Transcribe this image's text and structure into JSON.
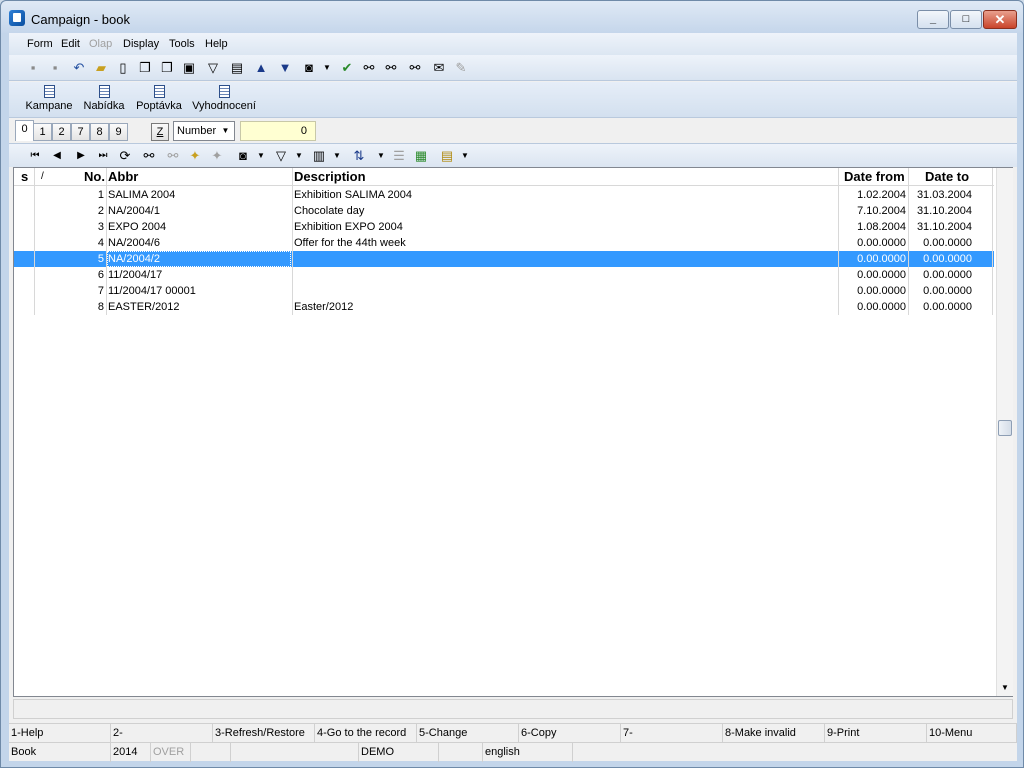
{
  "window": {
    "title": "Campaign - book",
    "minimize": "_",
    "maximize": "□",
    "close": "✕"
  },
  "menu": {
    "form": "Form",
    "edit": "Edit",
    "olap": "Olap",
    "display": "Display",
    "tools": "Tools",
    "help": "Help"
  },
  "toolbar2": {
    "kampane": "Kampane",
    "nabidka": "Nabídka",
    "poptavka": "Poptávka",
    "vyhodnoceni": "Vyhodnocení"
  },
  "tabs": [
    "0",
    "1",
    "2",
    "7",
    "8",
    "9"
  ],
  "filter": {
    "z_label": "Z",
    "sort_field": "Number",
    "value": "0"
  },
  "grid": {
    "headers": {
      "s": "s",
      "slash": "/",
      "no": "No.",
      "abbr": "Abbr",
      "description": "Description",
      "date_from": "Date from",
      "date_to": "Date to"
    },
    "rows": [
      {
        "no": "1",
        "abbr": "SALIMA 2004",
        "description": "Exhibition SALIMA 2004",
        "date_from": "1.02.2004",
        "date_to": "31.03.2004"
      },
      {
        "no": "2",
        "abbr": "NA/2004/1",
        "description": "Chocolate day",
        "date_from": "7.10.2004",
        "date_to": "31.10.2004"
      },
      {
        "no": "3",
        "abbr": "EXPO 2004",
        "description": "Exhibition EXPO 2004",
        "date_from": "1.08.2004",
        "date_to": "31.10.2004"
      },
      {
        "no": "4",
        "abbr": "NA/2004/6",
        "description": "Offer for the 44th week",
        "date_from": "0.00.0000",
        "date_to": "0.00.0000"
      },
      {
        "no": "5",
        "abbr": "NA/2004/2",
        "description": "",
        "date_from": "0.00.0000",
        "date_to": "0.00.0000"
      },
      {
        "no": "6",
        "abbr": "11/2004/17",
        "description": "",
        "date_from": "0.00.0000",
        "date_to": "0.00.0000"
      },
      {
        "no": "7",
        "abbr": "11/2004/17  00001",
        "description": "",
        "date_from": "0.00.0000",
        "date_to": "0.00.0000"
      },
      {
        "no": "8",
        "abbr": "EASTER/2012",
        "description": "Easter/2012",
        "date_from": "0.00.0000",
        "date_to": "0.00.0000"
      }
    ],
    "selected_index": 4
  },
  "fkeys": [
    "1-Help",
    "2-",
    "3-Refresh/Restore",
    "4-Go to the record",
    "5-Change",
    "6-Copy",
    "7-",
    "8-Make invalid",
    "9-Print",
    "10-Menu"
  ],
  "info": {
    "module": "Book",
    "year": "2014",
    "mode": "OVER",
    "db": "DEMO",
    "language": "english"
  }
}
